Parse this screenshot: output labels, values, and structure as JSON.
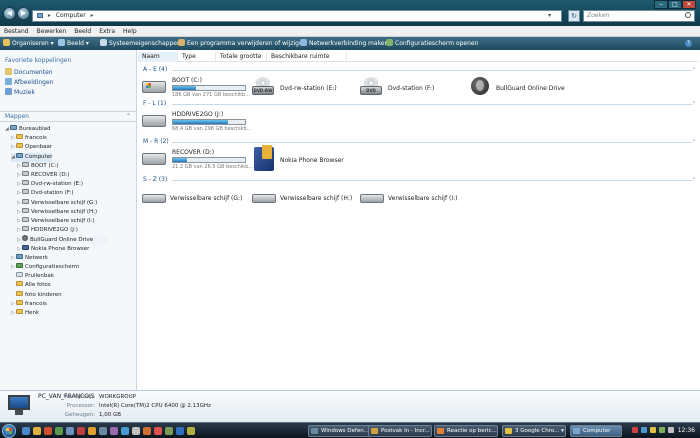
{
  "window": {
    "address_parts": [
      "Computer"
    ],
    "search_placeholder": "Zoeken",
    "controls": {
      "minimize": "‒",
      "maximize": "□",
      "close": "✕"
    }
  },
  "menubar": [
    "Bestand",
    "Bewerken",
    "Beeld",
    "Extra",
    "Help"
  ],
  "toolbar": [
    {
      "label": "Organiseren ▾",
      "icon": "organize-icon",
      "color": "#e7c25a"
    },
    {
      "label": "Beeld ▾",
      "icon": "views-icon",
      "color": "#9cc6e6"
    },
    {
      "label": "Systeemeigenschappen",
      "icon": "properties-icon",
      "color": "#c9d9e8"
    },
    {
      "label": "Een programma verwijderen of wijzigen",
      "icon": "uninstall-icon",
      "color": "#d8b26a"
    },
    {
      "label": "Netwerkverbinding maken",
      "icon": "network-icon",
      "color": "#8ab8e0"
    },
    {
      "label": "Configuratiescherm openen",
      "icon": "control-panel-icon",
      "color": "#7fb36a"
    }
  ],
  "leftpane": {
    "favorites_title": "Favoriete koppelingen",
    "favorites": [
      {
        "label": "Documenten",
        "icon": "documents-icon",
        "color": "#e4c46a"
      },
      {
        "label": "Afbeeldingen",
        "icon": "pictures-icon",
        "color": "#77b0d8"
      },
      {
        "label": "Muziek",
        "icon": "music-icon",
        "color": "#6f9fd6"
      }
    ],
    "folders_title": "Mappen",
    "tree": [
      {
        "label": "Bureaublad",
        "depth": 0,
        "exp": "◢",
        "icon": "desktop-icon",
        "type": "pc"
      },
      {
        "label": "francois",
        "depth": 1,
        "exp": "▷",
        "icon": "folder-icon",
        "type": "folder"
      },
      {
        "label": "Openbaar",
        "depth": 1,
        "exp": "▷",
        "icon": "folder-icon",
        "type": "folder"
      },
      {
        "label": "Computer",
        "depth": 1,
        "exp": "◢",
        "icon": "computer-icon",
        "type": "pc",
        "selected": true
      },
      {
        "label": "BOOT (C:)",
        "depth": 2,
        "exp": "▷",
        "icon": "drive-icon",
        "type": "drive"
      },
      {
        "label": "RECOVER (D:)",
        "depth": 2,
        "exp": "▷",
        "icon": "drive-icon",
        "type": "drive"
      },
      {
        "label": "Dvd-rw-station (E:)",
        "depth": 2,
        "exp": "▷",
        "icon": "dvd-drive-icon",
        "type": "drive"
      },
      {
        "label": "Dvd-station (F:)",
        "depth": 2,
        "exp": "▷",
        "icon": "dvd-drive-icon",
        "type": "drive"
      },
      {
        "label": "Verwisselbare schijf (G:)",
        "depth": 2,
        "exp": "▷",
        "icon": "removable-drive-icon",
        "type": "drive"
      },
      {
        "label": "Verwisselbare schijf (H:)",
        "depth": 2,
        "exp": "▷",
        "icon": "removable-drive-icon",
        "type": "drive"
      },
      {
        "label": "Verwisselbare schijf (I:)",
        "depth": 2,
        "exp": "▷",
        "icon": "removable-drive-icon",
        "type": "drive"
      },
      {
        "label": "HDDRIVE2GO (J:)",
        "depth": 2,
        "exp": "▷",
        "icon": "drive-icon",
        "type": "drive"
      },
      {
        "label": "BullGuard Online Drive",
        "depth": 2,
        "exp": "▷",
        "icon": "globe-icon",
        "type": "globe",
        "hover": true
      },
      {
        "label": "Nokia Phone Browser",
        "depth": 2,
        "exp": "▷",
        "icon": "phone-icon",
        "type": "phone"
      },
      {
        "label": "Netwerk",
        "depth": 1,
        "exp": "▷",
        "icon": "network-icon",
        "type": "net"
      },
      {
        "label": "Configuratiescherm",
        "depth": 1,
        "exp": "▷",
        "icon": "control-panel-icon",
        "type": "panel"
      },
      {
        "label": "Prullenbak",
        "depth": 1,
        "exp": "",
        "icon": "recycle-bin-icon",
        "type": "bin"
      },
      {
        "label": "Alle fotos",
        "depth": 1,
        "exp": "",
        "icon": "folder-icon",
        "type": "folder"
      },
      {
        "label": "foto kinderen",
        "depth": 1,
        "exp": "",
        "icon": "folder-icon",
        "type": "folder"
      },
      {
        "label": "francois",
        "depth": 1,
        "exp": "▷",
        "icon": "folder-icon",
        "type": "folder"
      },
      {
        "label": "Henk",
        "depth": 1,
        "exp": "▷",
        "icon": "folder-icon",
        "type": "folder"
      }
    ]
  },
  "columns": [
    "Naam",
    "Type",
    "Totale grootte",
    "Beschikbare ruimte"
  ],
  "groups": [
    {
      "label": "A - E (4)",
      "items": [
        {
          "kind": "hdd-win",
          "name": "BOOT (C:)",
          "bar": 0.32,
          "sub": "186 GB van 271 GB beschikb..."
        },
        {
          "kind": "dvd",
          "name": "Dvd-rw-station (E:)",
          "badge": "DVD-RW"
        },
        {
          "kind": "dvd",
          "name": "Dvd-station (F:)",
          "badge": "DVD"
        },
        {
          "kind": "globe",
          "name": "BullGuard Online Drive"
        }
      ]
    },
    {
      "label": "F - L (1)",
      "items": [
        {
          "kind": "hdd",
          "name": "HDDRIVE2GO (J:)",
          "bar": 0.77,
          "sub": "68,4 GB van 298 GB beschikb..."
        }
      ]
    },
    {
      "label": "M - R (2)",
      "items": [
        {
          "kind": "hdd",
          "name": "RECOVER (D:)",
          "bar": 0.2,
          "sub": "21,2 GB van 26,5 GB beschikb..."
        },
        {
          "kind": "phone",
          "name": "Nokia Phone Browser"
        }
      ]
    },
    {
      "label": "S - Z (3)",
      "items": [
        {
          "kind": "removable",
          "name": "Verwisselbare schijf (G:)"
        },
        {
          "kind": "removable",
          "name": "Verwisselbare schijf (H:)"
        },
        {
          "kind": "removable",
          "name": "Verwisselbare schijf (I:)"
        }
      ]
    }
  ],
  "details": {
    "name": "PC_VAN_FRANCOIS",
    "rows": [
      {
        "label": "Werkgroep:",
        "value": "WORKGROUP"
      },
      {
        "label": "Processor:",
        "value": "Intel(R) Core(TM)2 CPU        6400  @ 2.13GHz"
      },
      {
        "label": "Geheugen:",
        "value": "1,00 GB"
      }
    ]
  },
  "taskbar": {
    "quicklaunch_colors": [
      "#4a88c8",
      "#e0b040",
      "#d05030",
      "#5a9a4a",
      "#7090c0",
      "#c04040",
      "#e0a030",
      "#6a8aa0",
      "#9a6ab0",
      "#4a9ad0",
      "#c0c0c0",
      "#d07030",
      "#e05050",
      "#7a9a5a",
      "#3070c0",
      "#b0b040"
    ],
    "tasks": [
      {
        "label": "Windows Defen...",
        "icon_color": "#6a8aa0"
      },
      {
        "label": "Postvak In - Incr...",
        "icon_color": "#d0a040"
      },
      {
        "label": "Reactie op beric...",
        "icon_color": "#e08030"
      },
      {
        "label": "3 Google Chro... ▾",
        "icon_color": "#e0c040"
      },
      {
        "label": "Computer",
        "icon_color": "#7aa5c8",
        "active": true
      }
    ],
    "tray_colors": [
      "#d04040",
      "#4a9ad0",
      "#e0c040",
      "#7ab05a",
      "#c0c0c0"
    ],
    "clock": "12:36"
  }
}
